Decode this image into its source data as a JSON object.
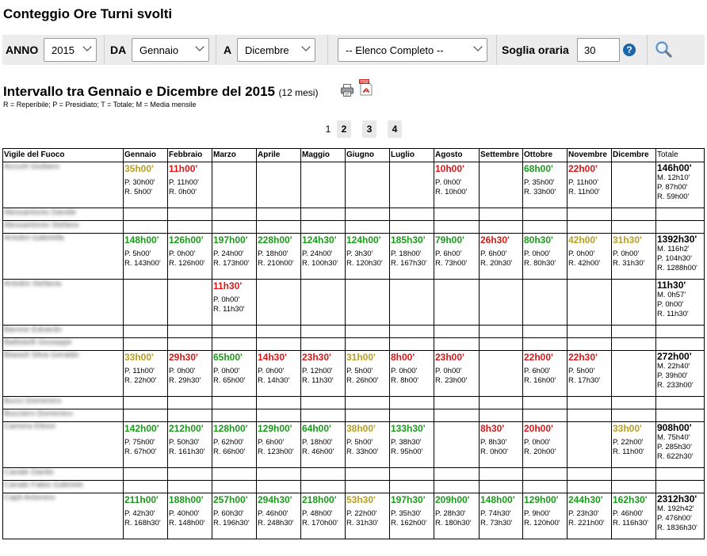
{
  "page": {
    "title": "Conteggio Ore Turni svolti"
  },
  "filters": {
    "anno_label": "ANNO",
    "anno_value": "2015",
    "da_label": "DA",
    "da_value": "Gennaio",
    "a_label": "A",
    "a_value": "Dicembre",
    "elenco_value": "-- Elenco Completo --",
    "soglia_label": "Soglia oraria",
    "soglia_value": "30",
    "help_glyph": "?",
    "search_icon": "magnifier-search-icon"
  },
  "report": {
    "heading": "Intervallo tra Gennaio e Dicembre del 2015",
    "months_count": "(12 mesi)",
    "legend": "R = Reperibile; P = Presidiato; T = Totale; M = Media mensile",
    "print_icon": "printer-icon",
    "pdf_icon": "pdf-icon",
    "pdf_text": "PDF"
  },
  "pagination": {
    "pages": [
      "1",
      "2",
      "3",
      "4"
    ],
    "current": "1"
  },
  "colors": {
    "green": "#1a9a1a",
    "red": "#d81818",
    "yellow": "#b8a020"
  },
  "table": {
    "headers": [
      "Vigile del Fuoco",
      "Gennaio",
      "Febbraio",
      "Marzo",
      "Aprile",
      "Maggio",
      "Giugno",
      "Luglio",
      "Agosto",
      "Settembre",
      "Ottobre",
      "Novembre",
      "Dicembre",
      "Totale"
    ],
    "rows": [
      {
        "name": "Accurti Giuliano",
        "cells": [
          {
            "h": "35h00'",
            "c": "y",
            "p": "P. 30h00'",
            "r": "R. 5h00'"
          },
          {
            "h": "11h00'",
            "c": "r",
            "p": "P. 11h00'",
            "r": "R. 0h00'"
          },
          null,
          null,
          null,
          null,
          null,
          {
            "h": "10h00'",
            "c": "r",
            "p": "P. 0h00'",
            "r": "R. 10h00'"
          },
          null,
          {
            "h": "68h00'",
            "c": "g",
            "p": "P. 35h00'",
            "r": "R. 33h00'"
          },
          {
            "h": "22h00'",
            "c": "r",
            "p": "P. 11h00'",
            "r": "R. 11h00'"
          },
          null
        ],
        "total": {
          "h": "146h00'",
          "m": "M. 12h10'",
          "p": "P. 87h00'",
          "r": "R. 59h00'"
        }
      },
      {
        "name": "Alessantonio Davide",
        "cells": [],
        "total": null
      },
      {
        "name": "Alessantonio Stefano",
        "cells": [],
        "total": null
      },
      {
        "name": "Antolini Gabriella",
        "cells": [
          {
            "h": "148h00'",
            "c": "g",
            "p": "P. 5h00'",
            "r": "R. 143h00'"
          },
          {
            "h": "126h00'",
            "c": "g",
            "p": "P. 0h00'",
            "r": "R. 126h00'"
          },
          {
            "h": "197h00'",
            "c": "g",
            "p": "P. 24h00'",
            "r": "R. 173h00'"
          },
          {
            "h": "228h00'",
            "c": "g",
            "p": "P. 18h00'",
            "r": "R. 210h00'"
          },
          {
            "h": "124h30'",
            "c": "g",
            "p": "P. 24h00'",
            "r": "R. 100h30'"
          },
          {
            "h": "124h00'",
            "c": "g",
            "p": "P. 3h30'",
            "r": "R. 120h30'"
          },
          {
            "h": "185h30'",
            "c": "g",
            "p": "P. 18h00'",
            "r": "R. 167h30'"
          },
          {
            "h": "79h00'",
            "c": "g",
            "p": "P. 6h00'",
            "r": "R. 73h00'"
          },
          {
            "h": "26h30'",
            "c": "r",
            "p": "P. 6h00'",
            "r": "R. 20h30'"
          },
          {
            "h": "80h30'",
            "c": "g",
            "p": "P. 0h00'",
            "r": "R. 80h30'"
          },
          {
            "h": "42h00'",
            "c": "y",
            "p": "P. 0h00'",
            "r": "R. 42h00'"
          },
          {
            "h": "31h30'",
            "c": "y",
            "p": "P. 0h00'",
            "r": "R. 31h30'"
          }
        ],
        "total": {
          "h": "1392h30'",
          "m": "M. 116h2'",
          "p": "P. 104h30'",
          "r": "R. 1288h00'"
        }
      },
      {
        "name": "Antolini Stefania",
        "cells": [
          null,
          null,
          {
            "h": "11h30'",
            "c": "r",
            "p": "P. 0h00'",
            "r": "R. 11h30'"
          },
          null,
          null,
          null,
          null,
          null,
          null,
          null,
          null,
          null
        ],
        "total": {
          "h": "11h30'",
          "m": "M. 0h57'",
          "p": "P. 0h00'",
          "r": "R. 11h30'"
        }
      },
      {
        "name": "Barone Edoardo",
        "cells": [],
        "total": null
      },
      {
        "name": "Battistelli Giuseppe",
        "cells": [],
        "total": null
      },
      {
        "name": "Biasioli Silva Geraldo",
        "cells": [
          {
            "h": "33h00'",
            "c": "y",
            "p": "P. 11h00'",
            "r": "R. 22h00'"
          },
          {
            "h": "29h30'",
            "c": "r",
            "p": "P. 0h00'",
            "r": "R. 29h30'"
          },
          {
            "h": "65h00'",
            "c": "g",
            "p": "P. 0h00'",
            "r": "R. 65h00'"
          },
          {
            "h": "14h30'",
            "c": "r",
            "p": "P. 0h00'",
            "r": "R. 14h30'"
          },
          {
            "h": "23h30'",
            "c": "r",
            "p": "P. 12h00'",
            "r": "R. 11h30'"
          },
          {
            "h": "31h00'",
            "c": "y",
            "p": "P. 5h00'",
            "r": "R. 26h00'"
          },
          {
            "h": "8h00'",
            "c": "r",
            "p": "P. 0h00'",
            "r": "R. 8h00'"
          },
          {
            "h": "23h00'",
            "c": "r",
            "p": "P. 0h00'",
            "r": "R. 23h00'"
          },
          null,
          {
            "h": "22h00'",
            "c": "r",
            "p": "P. 6h00'",
            "r": "R. 16h00'"
          },
          {
            "h": "22h30'",
            "c": "r",
            "p": "P. 5h00'",
            "r": "R. 17h30'"
          },
          null
        ],
        "total": {
          "h": "272h00'",
          "m": "M. 22h40'",
          "p": "P. 39h00'",
          "r": "R. 233h00'"
        }
      },
      {
        "name": "Bucci Domenico",
        "cells": [],
        "total": null
      },
      {
        "name": "Bucciero Domenico",
        "cells": [],
        "total": null
      },
      {
        "name": "Camera Ettore",
        "cells": [
          {
            "h": "142h00'",
            "c": "g",
            "p": "P. 75h00'",
            "r": "R. 67h00'"
          },
          {
            "h": "212h00'",
            "c": "g",
            "p": "P. 50h30'",
            "r": "R. 161h30'"
          },
          {
            "h": "128h00'",
            "c": "g",
            "p": "P. 62h00'",
            "r": "R. 66h00'"
          },
          {
            "h": "129h00'",
            "c": "g",
            "p": "P. 6h00'",
            "r": "R. 123h00'"
          },
          {
            "h": "64h00'",
            "c": "g",
            "p": "P. 18h00'",
            "r": "R. 46h00'"
          },
          {
            "h": "38h00'",
            "c": "y",
            "p": "P. 5h00'",
            "r": "R. 33h00'"
          },
          {
            "h": "133h30'",
            "c": "g",
            "p": "P. 38h30'",
            "r": "R. 95h00'"
          },
          null,
          {
            "h": "8h30'",
            "c": "r",
            "p": "P. 8h30'",
            "r": "R. 0h00'"
          },
          {
            "h": "20h00'",
            "c": "r",
            "p": "P. 0h00'",
            "r": "R. 20h00'"
          },
          null,
          {
            "h": "33h00'",
            "c": "y",
            "p": "P. 22h00'",
            "r": "R. 11h00'"
          }
        ],
        "total": {
          "h": "908h00'",
          "m": "M. 75h40'",
          "p": "P. 285h30'",
          "r": "R. 622h30'"
        }
      },
      {
        "name": "Canale Danilo",
        "cells": [],
        "total": null
      },
      {
        "name": "Canale Fabio Gabriele",
        "cells": [],
        "total": null
      },
      {
        "name": "Capil Antonino",
        "cells": [
          {
            "h": "211h00'",
            "c": "g",
            "p": "P. 42h30'",
            "r": "R. 168h30'"
          },
          {
            "h": "188h00'",
            "c": "g",
            "p": "P. 40h00'",
            "r": "R. 148h00'"
          },
          {
            "h": "257h00'",
            "c": "g",
            "p": "P. 60h30'",
            "r": "R. 196h30'"
          },
          {
            "h": "294h30'",
            "c": "g",
            "p": "P. 46h00'",
            "r": "R. 248h30'"
          },
          {
            "h": "218h00'",
            "c": "g",
            "p": "P. 48h00'",
            "r": "R. 170h00'"
          },
          {
            "h": "53h30'",
            "c": "y",
            "p": "P. 22h00'",
            "r": "R. 31h30'"
          },
          {
            "h": "197h30'",
            "c": "g",
            "p": "P. 35h30'",
            "r": "R. 162h00'"
          },
          {
            "h": "209h00'",
            "c": "g",
            "p": "P. 28h30'",
            "r": "R. 180h30'"
          },
          {
            "h": "148h00'",
            "c": "g",
            "p": "P. 74h30'",
            "r": "R. 73h30'"
          },
          {
            "h": "129h00'",
            "c": "g",
            "p": "P. 9h00'",
            "r": "R. 120h00'"
          },
          {
            "h": "244h30'",
            "c": "g",
            "p": "P. 23h30'",
            "r": "R. 221h00'"
          },
          {
            "h": "162h30'",
            "c": "g",
            "p": "P. 46h00'",
            "r": "R. 116h30'"
          }
        ],
        "total": {
          "h": "2312h30'",
          "m": "M. 192h42'",
          "p": "P. 476h00'",
          "r": "R. 1836h30'"
        }
      }
    ]
  }
}
